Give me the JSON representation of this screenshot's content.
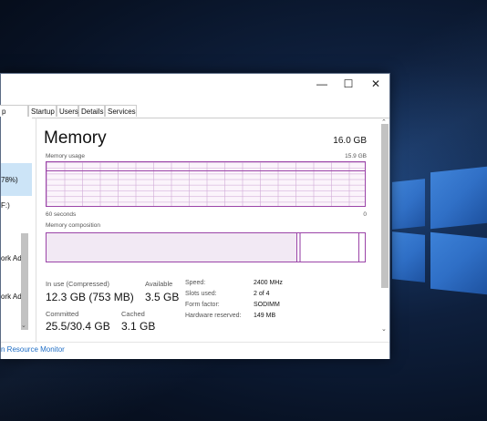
{
  "window": {
    "controls": {
      "minimize": "—",
      "maximize": "☐",
      "close": "✕"
    },
    "tabs": [
      "p history",
      "Startup",
      "Users",
      "Details",
      "Services"
    ]
  },
  "sidebar": {
    "items": [
      "78%)",
      "F:)",
      "ork Ad",
      "ork Ad"
    ],
    "scroll_down": "⌄"
  },
  "memory": {
    "title": "Memory",
    "total": "16.0 GB",
    "usage_label": "Memory usage",
    "usage_max": "15.9 GB",
    "time_label": "60 seconds",
    "time_end": "0",
    "usage_level": 0.82,
    "composition_label": "Memory composition",
    "in_use_label": "In use (Compressed)",
    "in_use_value": "12.3 GB (753 MB)",
    "available_label": "Available",
    "available_value": "3.5 GB",
    "committed_label": "Committed",
    "committed_value": "25.5/30.4 GB",
    "cached_label": "Cached",
    "cached_value": "3.1 GB",
    "specs": [
      {
        "label": "Speed:",
        "value": "2400 MHz"
      },
      {
        "label": "Slots used:",
        "value": "2 of 4"
      },
      {
        "label": "Form factor:",
        "value": "SODIMM"
      },
      {
        "label": "Hardware reserved:",
        "value": "149 MB"
      }
    ]
  },
  "footer": {
    "link": "n Resource Monitor"
  },
  "colors": {
    "accent": "#9b44a8",
    "link": "#1f6ec6",
    "selection": "#cce4f7",
    "windows_logo": "#2f6fc6"
  }
}
